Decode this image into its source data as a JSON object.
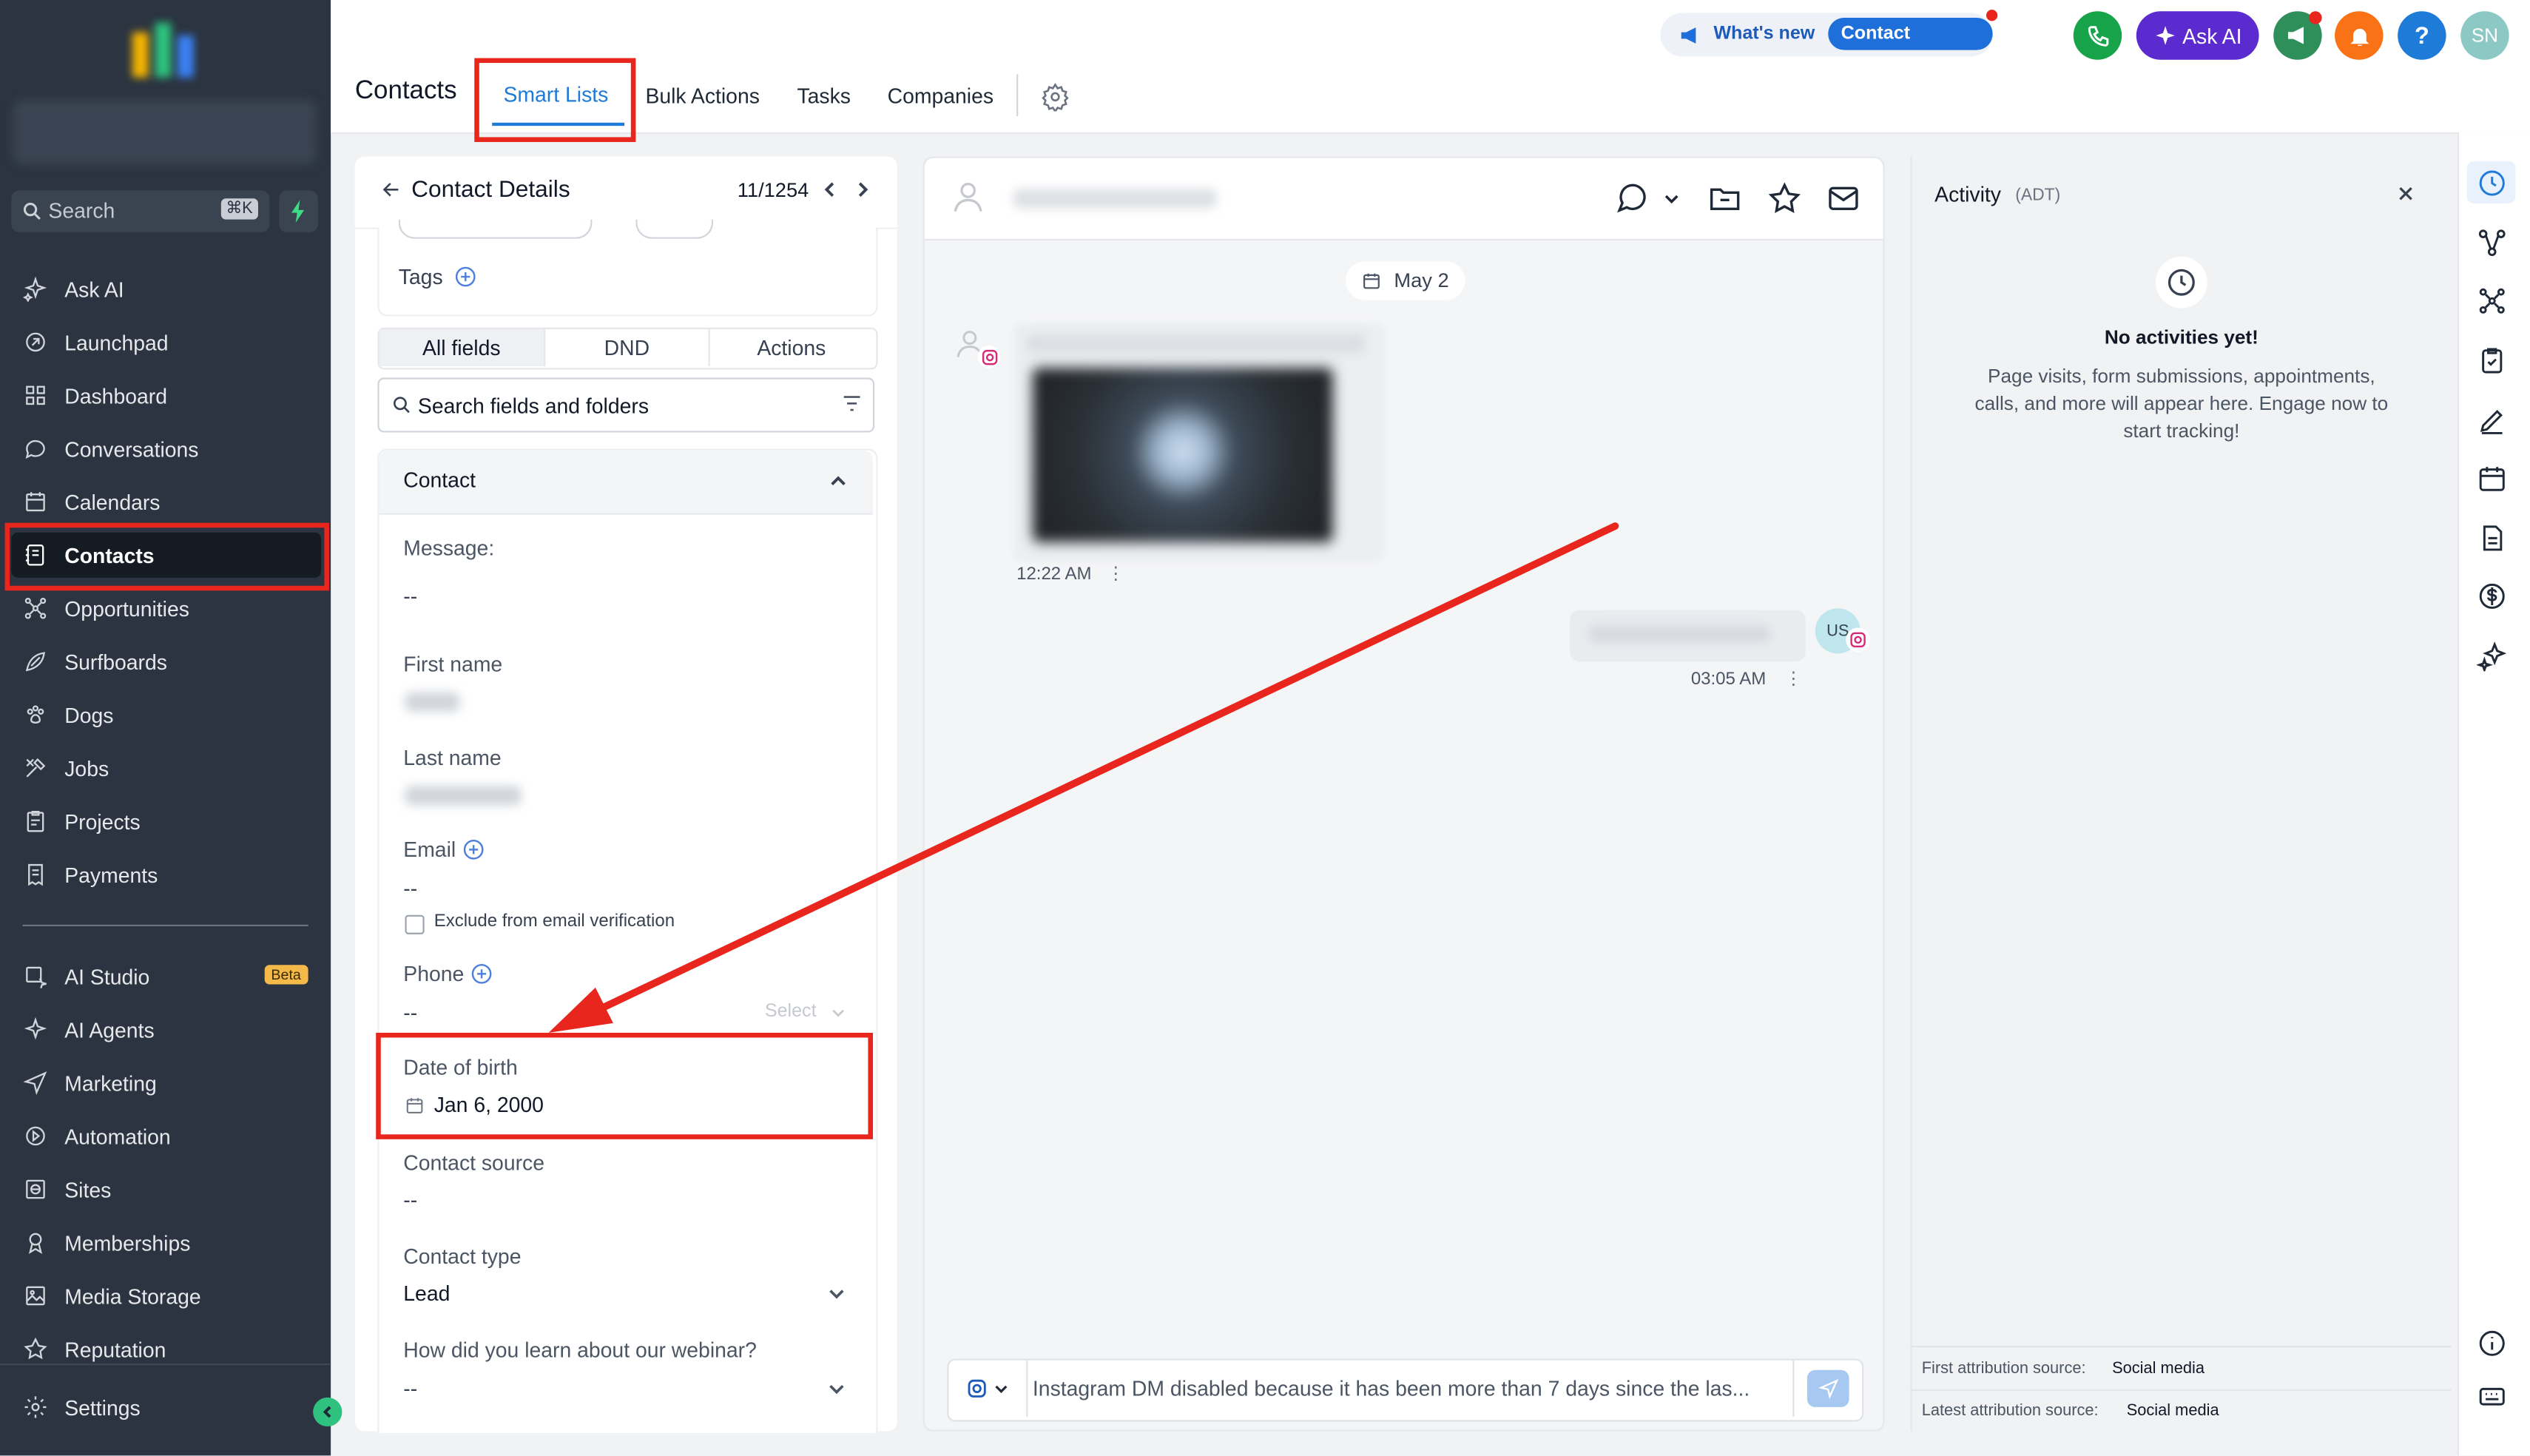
{
  "sidebar": {
    "search": {
      "label": "Search",
      "shortcut": "⌘K"
    },
    "nav": [
      {
        "label": "Ask AI",
        "icon": "sparkle-icon"
      },
      {
        "label": "Launchpad",
        "icon": "rocket-icon"
      },
      {
        "label": "Dashboard",
        "icon": "grid-icon"
      },
      {
        "label": "Conversations",
        "icon": "chat-bubble-icon"
      },
      {
        "label": "Calendars",
        "icon": "calendar-icon"
      },
      {
        "label": "Contacts",
        "icon": "contact-book-icon"
      },
      {
        "label": "Opportunities",
        "icon": "network-icon"
      },
      {
        "label": "Surfboards",
        "icon": "surfboard-icon"
      },
      {
        "label": "Dogs",
        "icon": "paw-icon"
      },
      {
        "label": "Jobs",
        "icon": "tools-icon"
      },
      {
        "label": "Projects",
        "icon": "clipboard-icon"
      },
      {
        "label": "Payments",
        "icon": "receipt-icon"
      }
    ],
    "nav2": [
      {
        "label": "AI Studio",
        "icon": "ai-studio-icon",
        "badge": "Beta"
      },
      {
        "label": "AI Agents",
        "icon": "sparkle-icon"
      },
      {
        "label": "Marketing",
        "icon": "send-icon"
      },
      {
        "label": "Automation",
        "icon": "automation-icon"
      },
      {
        "label": "Sites",
        "icon": "globe-icon"
      },
      {
        "label": "Memberships",
        "icon": "award-icon"
      },
      {
        "label": "Media Storage",
        "icon": "image-icon"
      },
      {
        "label": "Reputation",
        "icon": "star-icon"
      }
    ],
    "settings": "Settings"
  },
  "topbar": {
    "title": "Contacts",
    "tabs": [
      "Smart Lists",
      "Bulk Actions",
      "Tasks",
      "Companies"
    ],
    "whats_new": "What's new",
    "contact_updates": "Contact updates",
    "ask_ai": "Ask AI",
    "help": "?",
    "avatar": "SN"
  },
  "details": {
    "title": "Contact Details",
    "pager": "11/1254",
    "tags_label": "Tags",
    "seg_tabs": [
      "All fields",
      "DND",
      "Actions"
    ],
    "search_placeholder": "Search fields and folders",
    "section": "Contact",
    "message_label": "Message:",
    "message_value": "--",
    "first_name_label": "First name",
    "last_name_label": "Last name",
    "email_label": "Email",
    "email_value": "--",
    "exclude_label": "Exclude from email verification",
    "phone_label": "Phone",
    "phone_value": "--",
    "phone_select": "Select",
    "dob_label": "Date of birth",
    "dob_value": "Jan 6, 2000",
    "source_label": "Contact source",
    "source_value": "--",
    "type_label": "Contact type",
    "type_value": "Lead",
    "webinar_label": "How did you learn about our webinar?",
    "webinar_value": "--"
  },
  "conversation": {
    "date_chip": "May 2",
    "msg1_time": "12:22 AM",
    "msg2_time": "03:05 AM",
    "user_avatar": "US",
    "composer_text": "Instagram DM disabled because it has been more than 7 days since the las..."
  },
  "activity": {
    "title": "Activity",
    "tz": "(ADT)",
    "empty_title": "No activities yet!",
    "empty_text": "Page visits, form submissions, appointments, calls, and more will appear here. Engage now to start tracking!",
    "first_attr_label": "First attribution source:",
    "first_attr_value": "Social media",
    "latest_attr_label": "Latest attribution source:",
    "latest_attr_value": "Social media"
  },
  "colors": {
    "sidebar": "#2b3440",
    "accent": "#1e7bd8",
    "annotation": "#e8261d",
    "ask_ai": "#5b2bd0"
  }
}
